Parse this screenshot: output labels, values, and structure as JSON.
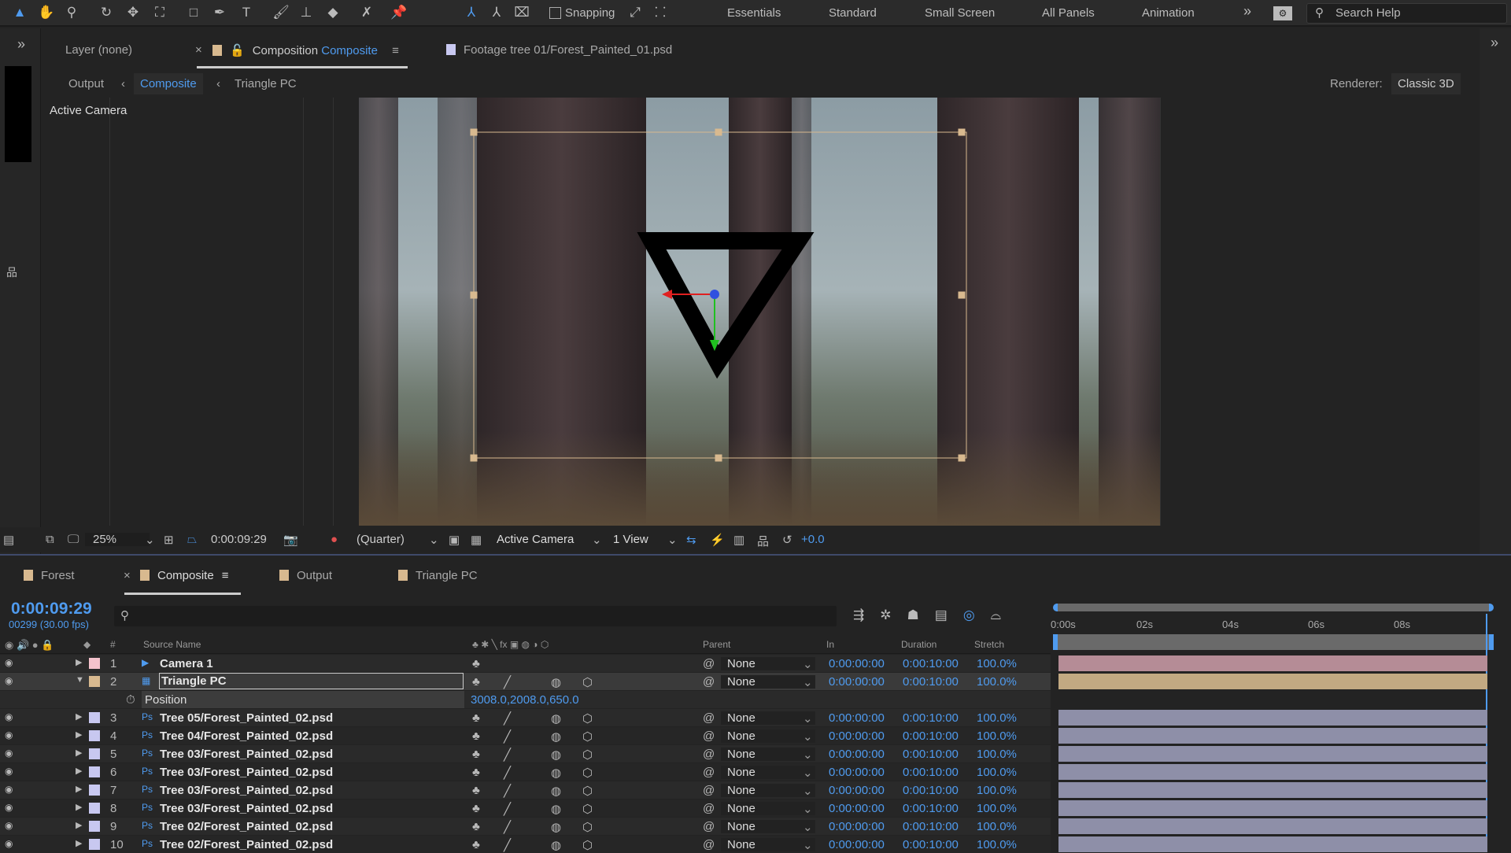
{
  "toolbar": {
    "snapping": "Snapping",
    "workspaces": [
      "Essentials",
      "Standard",
      "Small Screen",
      "All Panels",
      "Animation"
    ],
    "more": "»",
    "search_placeholder": "Search Help"
  },
  "panels": {
    "layer_tab": "Layer (none)",
    "comp_tab_prefix": "Composition",
    "comp_tab_name": "Composite",
    "footage_tab": "Footage tree 01/Forest_Painted_01.psd"
  },
  "breadcrumb": [
    "Output",
    "Composite",
    "Triangle PC"
  ],
  "renderer": {
    "label": "Renderer:",
    "value": "Classic 3D"
  },
  "viewer": {
    "label": "Active Camera",
    "accent": "#4f9bef"
  },
  "viewer_toolbar": {
    "zoom": "25%",
    "timecode": "0:00:09:29",
    "resolution": "(Quarter)",
    "camera": "Active Camera",
    "views": "1 View",
    "exposure": "+0.0"
  },
  "timeline_tabs": [
    {
      "label": "Forest",
      "color": "#d8b98f"
    },
    {
      "label": "Composite",
      "color": "#d8b98f"
    },
    {
      "label": "Output",
      "color": "#d8b98f"
    },
    {
      "label": "Triangle PC",
      "color": "#d8b98f"
    }
  ],
  "timeline": {
    "current_time": "0:00:09:29",
    "frame_info": "00299 (30.00 fps)",
    "ruler": [
      "0:00s",
      "02s",
      "04s",
      "06s",
      "08s"
    ]
  },
  "columns": {
    "num": "#",
    "source": "Source Name",
    "parent": "Parent",
    "in": "In",
    "duration": "Duration",
    "stretch": "Stretch"
  },
  "layers": [
    {
      "num": "1",
      "name": "Camera 1",
      "color": "#f4c2cc",
      "type": "camera",
      "parent": "None",
      "in": "0:00:00:00",
      "duration": "0:00:10:00",
      "stretch": "100.0%",
      "bar": "#b58c96"
    },
    {
      "num": "2",
      "name": "Triangle PC",
      "color": "#d8b98f",
      "type": "comp",
      "parent": "None",
      "in": "0:00:00:00",
      "duration": "0:00:10:00",
      "stretch": "100.0%",
      "bar": "#c2a982",
      "expanded": true,
      "selected": true
    },
    {
      "num": "3",
      "name": "Tree 05/Forest_Painted_02.psd",
      "color": "#c8c8f0",
      "type": "psd",
      "parent": "None",
      "in": "0:00:00:00",
      "duration": "0:00:10:00",
      "stretch": "100.0%",
      "bar": "#8e8fa8"
    },
    {
      "num": "4",
      "name": "Tree 04/Forest_Painted_02.psd",
      "color": "#c8c8f0",
      "type": "psd",
      "parent": "None",
      "in": "0:00:00:00",
      "duration": "0:00:10:00",
      "stretch": "100.0%",
      "bar": "#8e8fa8"
    },
    {
      "num": "5",
      "name": "Tree 03/Forest_Painted_02.psd",
      "color": "#c8c8f0",
      "type": "psd",
      "parent": "None",
      "in": "0:00:00:00",
      "duration": "0:00:10:00",
      "stretch": "100.0%",
      "bar": "#8e8fa8"
    },
    {
      "num": "6",
      "name": "Tree 03/Forest_Painted_02.psd",
      "color": "#c8c8f0",
      "type": "psd",
      "parent": "None",
      "in": "0:00:00:00",
      "duration": "0:00:10:00",
      "stretch": "100.0%",
      "bar": "#8e8fa8"
    },
    {
      "num": "7",
      "name": "Tree 03/Forest_Painted_02.psd",
      "color": "#c8c8f0",
      "type": "psd",
      "parent": "None",
      "in": "0:00:00:00",
      "duration": "0:00:10:00",
      "stretch": "100.0%",
      "bar": "#8e8fa8"
    },
    {
      "num": "8",
      "name": "Tree 03/Forest_Painted_02.psd",
      "color": "#c8c8f0",
      "type": "psd",
      "parent": "None",
      "in": "0:00:00:00",
      "duration": "0:00:10:00",
      "stretch": "100.0%",
      "bar": "#8e8fa8"
    },
    {
      "num": "9",
      "name": "Tree 02/Forest_Painted_02.psd",
      "color": "#c8c8f0",
      "type": "psd",
      "parent": "None",
      "in": "0:00:00:00",
      "duration": "0:00:10:00",
      "stretch": "100.0%",
      "bar": "#8e8fa8"
    },
    {
      "num": "10",
      "name": "Tree 02/Forest_Painted_02.psd",
      "color": "#c8c8f0",
      "type": "psd",
      "parent": "None",
      "in": "0:00:00:00",
      "duration": "0:00:10:00",
      "stretch": "100.0%",
      "bar": "#8e8fa8"
    }
  ],
  "property": {
    "name": "Position",
    "value": "3008.0,2008.0,650.0"
  }
}
